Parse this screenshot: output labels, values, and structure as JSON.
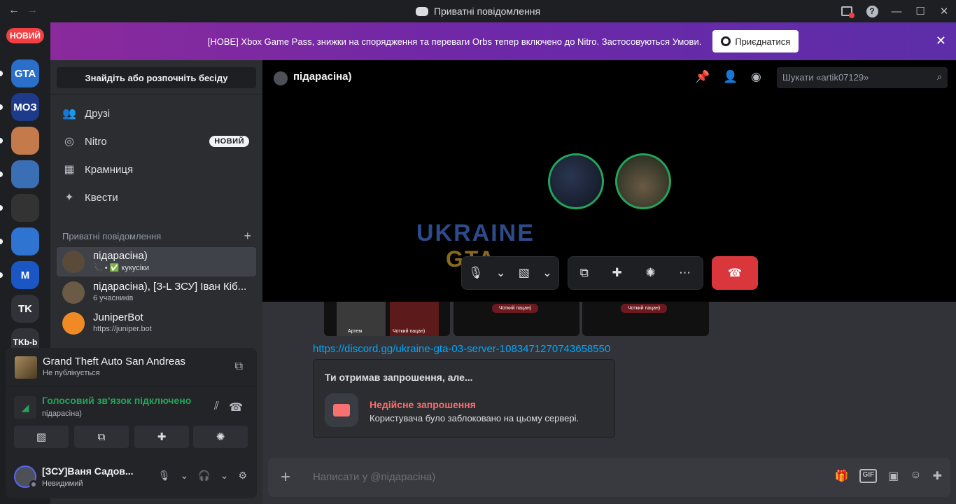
{
  "window": {
    "title": "Приватні повідомлення",
    "back_icon": "←",
    "forward_icon": "→",
    "minimize": "—",
    "maximize": "☐",
    "close": "✕"
  },
  "rail": {
    "new_label": "НОВИЙ",
    "servers": [
      {
        "name": "Ukraine GTA",
        "label": "GTA",
        "color": "#2a6fc9"
      },
      {
        "name": "МОЗ",
        "label": "МОЗ",
        "color": "#1e3a8a"
      },
      {
        "name": "hand",
        "label": "",
        "color": "#c47a4a"
      },
      {
        "name": "police",
        "label": "",
        "color": "#3b6fb5"
      },
      {
        "name": "club",
        "label": "",
        "color": "#333333"
      },
      {
        "name": "trident",
        "label": "",
        "color": "#2f74d0"
      },
      {
        "name": "M",
        "label": "M",
        "color": "#1a56c4"
      },
      {
        "name": "TK",
        "label": "TK",
        "color": "#313338"
      },
      {
        "name": "TKb-b",
        "label": "TKb-b",
        "color": "#313338"
      }
    ]
  },
  "banner": {
    "text": "[НОВЕ] Xbox Game Pass, знижки на спорядження та переваги Orbs тепер включено до Nitro. Застосовуються Умови.",
    "button": "Приєднатися"
  },
  "sidebar": {
    "find": "Знайдіть або розпочніть бесіду",
    "nav": [
      {
        "label": "Друзі",
        "icon": "👥"
      },
      {
        "label": "Nitro",
        "icon": "◎",
        "badge": "НОВИЙ"
      },
      {
        "label": "Крамниця",
        "icon": "▦"
      },
      {
        "label": "Квести",
        "icon": "✦"
      }
    ],
    "dm_header": "Приватні повідомлення",
    "dms": [
      {
        "name": "підарасіна)",
        "status": "📞 • ✅ кукусіки",
        "active": true,
        "color": "#5a4a3a"
      },
      {
        "name": "підарасіна), [З-L ЗСУ] Іван Кіб...",
        "status": "6 учасників",
        "active": false,
        "color": "#6b5a45"
      },
      {
        "name": "JuniperBot",
        "status": "https://juniper.bot",
        "active": false,
        "color": "#f08a24"
      }
    ]
  },
  "panel": {
    "game_title": "Grand Theft Auto San Andreas",
    "game_status": "Не публікується",
    "voice_title": "Голосовий зв'язок підключено",
    "voice_channel": "підарасіна)",
    "user_name": "[ЗСУ]Ваня Садов...",
    "user_status": "Невидимий"
  },
  "main": {
    "channel_name": "підарасіна)",
    "search_placeholder": "Шукати «artik07129»",
    "watermark_1": "UKRAINE",
    "watermark_2": "GTA",
    "thumb_label_1": "Чоткий пацан)",
    "thumb_label_2": "Чоткий пацан)",
    "thumb_label_3": "Чоткий пацан)",
    "thumb_name": "Артем",
    "link": "https://discord.gg/ukraine-gta-03-server-1083471270743658550",
    "invite_header": "Ти отримав запрошення, але...",
    "invite_title": "Недійсне запрошення",
    "invite_desc": "Користувача було заблоковано на цьому сервері.",
    "composer_placeholder": "Написати у @підарасіна)"
  }
}
